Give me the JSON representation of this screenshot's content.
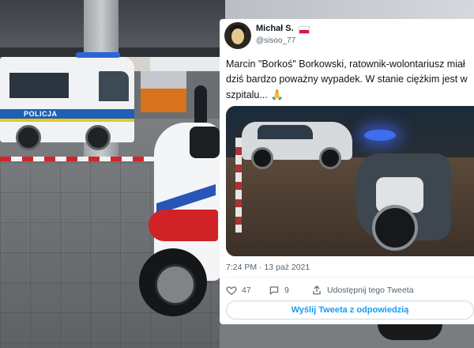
{
  "photo": {
    "van_label": "POLICJA"
  },
  "tweet": {
    "author_name": "Michał S.",
    "author_handle": "@sisoo_77",
    "text": "Marcin \"Borkoś\" Borkowski, ratownik-wolontariusz miał dziś bardzo poważny wypadek. W stanie ciężkim jest w szpitalu...",
    "timestamp": "7:24 PM · 13 paź 2021",
    "likes_count": "47",
    "replies_count": "9",
    "share_label": "Udostępnij tego Tweeta",
    "reply_cta": "Wyślij Tweeta z odpowiedzią",
    "icons": {
      "like": "heart-icon",
      "reply": "comment-icon",
      "share": "share-icon",
      "emoji": "praying-hands-icon"
    }
  },
  "colors": {
    "link_blue": "#1d9bf0",
    "police_blue": "#1f5fb4",
    "text_gray": "#536471"
  }
}
